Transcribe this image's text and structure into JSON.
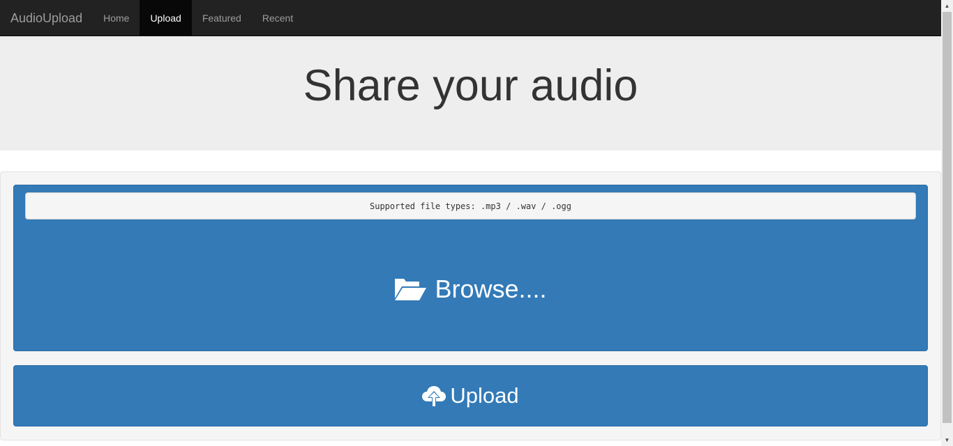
{
  "navbar": {
    "brand": "AudioUpload",
    "items": [
      {
        "label": "Home",
        "active": false
      },
      {
        "label": "Upload",
        "active": true
      },
      {
        "label": "Featured",
        "active": false
      },
      {
        "label": "Recent",
        "active": false
      }
    ]
  },
  "jumbotron": {
    "title": "Share your audio"
  },
  "upload_form": {
    "supported_types": "Supported file types: .mp3 / .wav / .ogg",
    "browse_label": "Browse....",
    "browse_icon": "folder-open-icon",
    "upload_label": "Upload",
    "upload_icon": "cloud-upload-icon"
  },
  "colors": {
    "navbar_bg": "#222222",
    "nav_active_bg": "#080808",
    "primary": "#337ab7",
    "jumbotron_bg": "#eeeeee"
  }
}
